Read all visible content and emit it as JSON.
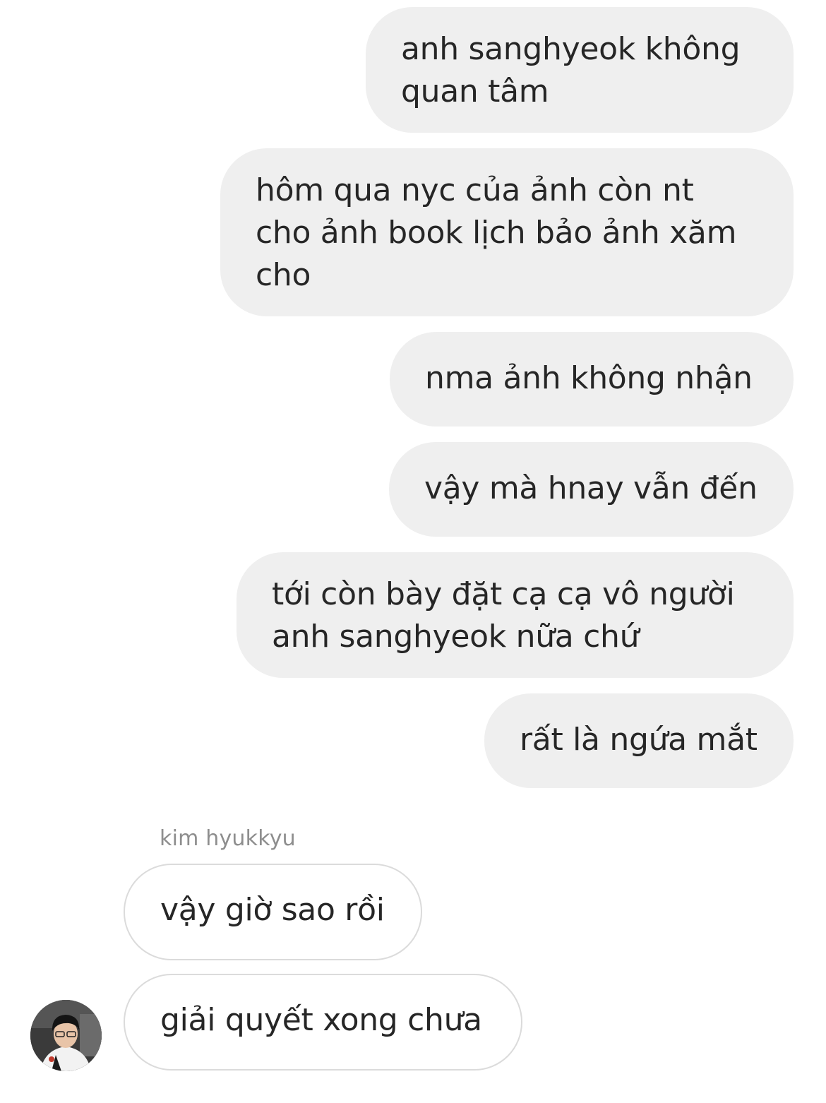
{
  "conversation": {
    "outgoing_messages": [
      {
        "text": "anh sanghyeok không\nquan tâm"
      },
      {
        "text": "hôm qua nyc của ảnh còn nt\ncho ảnh book lịch bảo ảnh xăm\ncho"
      },
      {
        "text": "nma ảnh không nhận"
      },
      {
        "text": "vậy mà hnay vẫn đến"
      },
      {
        "text": "tới còn bày đặt cạ cạ vô người\nanh sanghyeok nữa chứ"
      },
      {
        "text": "rất là ngứa mắt"
      }
    ],
    "incoming": {
      "sender_name": "kim hyukkyu",
      "messages": [
        {
          "text": "vậy giờ sao rồi"
        },
        {
          "text": "giải quyết xong chưa"
        }
      ]
    }
  },
  "colors": {
    "outgoing_bubble": "#efefef",
    "incoming_border": "#dbdbdb",
    "text": "#262626",
    "sender_name": "#8e8e8e"
  }
}
